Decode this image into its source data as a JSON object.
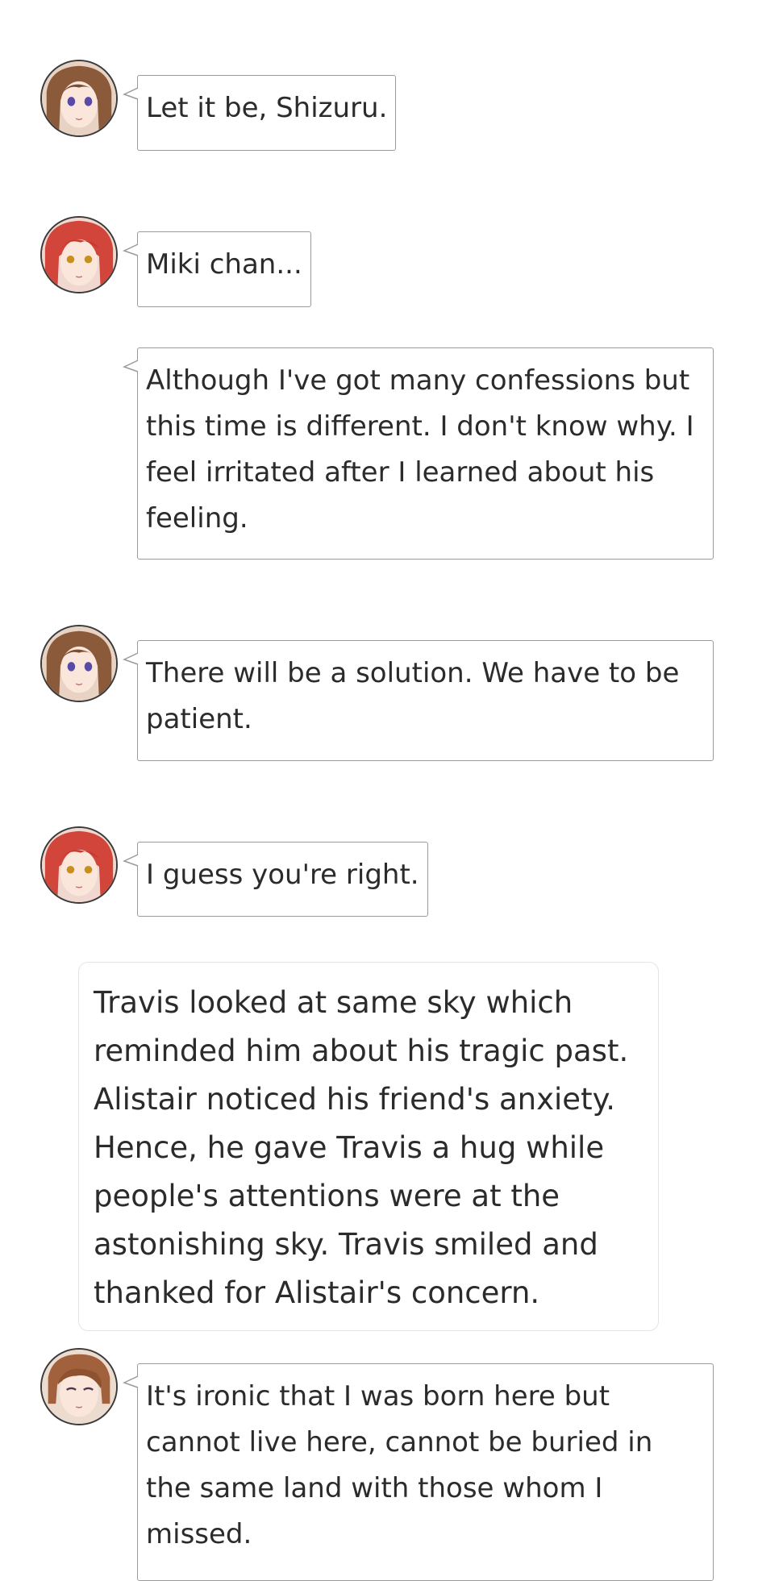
{
  "messages": [
    {
      "speaker": "brown-haired-girl",
      "avatar_icon": "brown-haired-girl-avatar-icon",
      "text": "Let it be, Shizuru."
    },
    {
      "speaker": "red-haired-girl",
      "avatar_icon": "red-haired-girl-avatar-icon",
      "text": "Miki chan..."
    },
    {
      "speaker": "red-haired-girl",
      "avatar_icon": null,
      "text": "Although I've got many confessions but this time is different. I don't know why. I feel irritated after I learned about his feeling."
    },
    {
      "speaker": "brown-haired-girl",
      "avatar_icon": "brown-haired-girl-avatar-icon",
      "text": "There will be a solution. We have to be patient."
    },
    {
      "speaker": "red-haired-girl",
      "avatar_icon": "red-haired-girl-avatar-icon",
      "text": "I guess you're right."
    },
    {
      "speaker": "brown-haired-boy",
      "avatar_icon": "brown-haired-boy-avatar-icon",
      "text": "It's ironic that I was born here but cannot live here, cannot be buried in the same land with those whom I missed."
    }
  ],
  "narration": {
    "text": "Travis looked at same sky which reminded him about his tragic past. Alistair noticed his friend's anxiety. Hence, he gave Travis a hug while people's attentions were at the astonishing sky. Travis smiled and thanked for Alistair's concern."
  },
  "colors": {
    "bubble_border": "#9a9a9a",
    "narration_border": "#e4e4e4",
    "text": "#2b2b2b",
    "brown_hair": "#8a5a3a",
    "red_hair": "#d2453a",
    "boy_hair": "#a0613c"
  }
}
